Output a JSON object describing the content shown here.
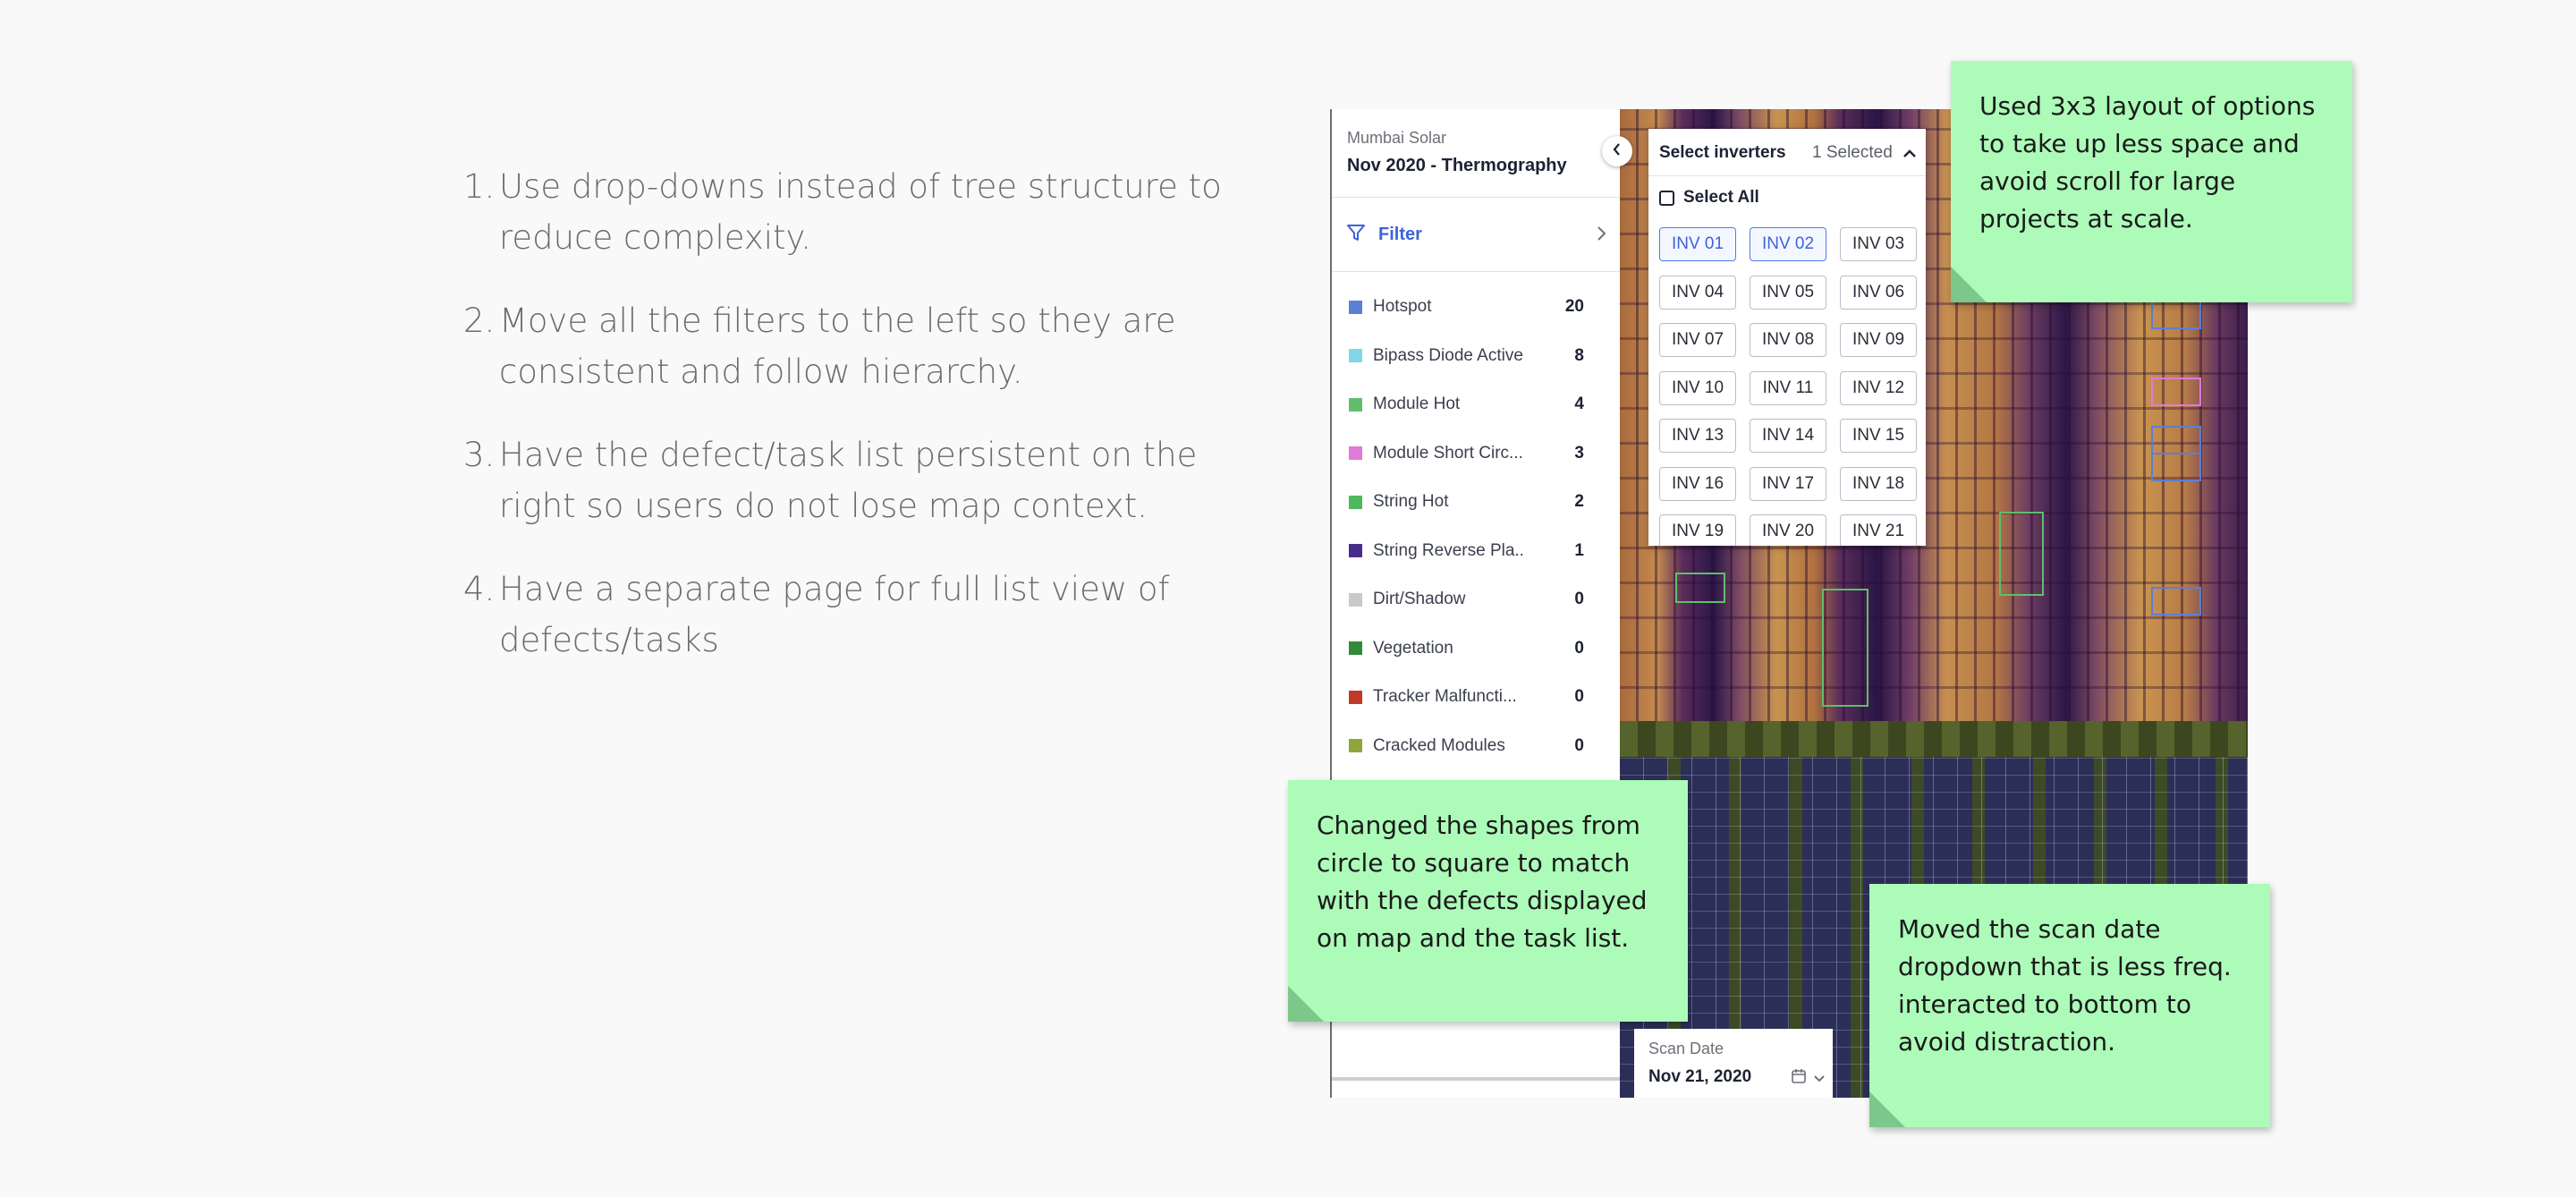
{
  "notes": [
    {
      "num": "1.",
      "text": "Use drop-downs instead of tree structure to reduce complexity."
    },
    {
      "num": "2.",
      "text": "Move all the filters to the left so they are consistent and follow hierarchy."
    },
    {
      "num": "3.",
      "text": "Have the defect/task list persistent on the right so users do not lose map context."
    },
    {
      "num": "4.",
      "text": "Have a separate page for full list view of defects/tasks"
    }
  ],
  "panel": {
    "site": "Mumbai Solar",
    "scan": "Nov 2020 - Thermography",
    "filter_label": "Filter",
    "defects": [
      {
        "name": "Hotspot",
        "count": "20",
        "color": "#5b7fd4"
      },
      {
        "name": "Bipass Diode Active",
        "count": "8",
        "color": "#7fd7e8"
      },
      {
        "name": "Module Hot",
        "count": "4",
        "color": "#5fbf6a"
      },
      {
        "name": "Module Short Circ...",
        "count": "3",
        "color": "#e07ad8"
      },
      {
        "name": "String Hot",
        "count": "2",
        "color": "#4fb85c"
      },
      {
        "name": "String Reverse Pla..",
        "count": "1",
        "color": "#4a2c8f"
      },
      {
        "name": "Dirt/Shadow",
        "count": "0",
        "color": "#c9c9c9"
      },
      {
        "name": "Vegetation",
        "count": "0",
        "color": "#2f8a3a"
      },
      {
        "name": "Tracker Malfuncti...",
        "count": "0",
        "color": "#c0392b"
      },
      {
        "name": "Cracked Modules",
        "count": "0",
        "color": "#8fa63a"
      }
    ]
  },
  "inverters": {
    "title": "Select inverters",
    "selected_text": "1 Selected",
    "select_all": "Select All",
    "options": [
      "INV 01",
      "INV 02",
      "INV 03",
      "INV 04",
      "INV 05",
      "INV 06",
      "INV 07",
      "INV 08",
      "INV 09",
      "INV 10",
      "INV 11",
      "INV 12",
      "INV 13",
      "INV 14",
      "INV 15",
      "INV 16",
      "INV 17",
      "INV 18",
      "INV 19",
      "INV 20",
      "INV 21"
    ],
    "highlighted": [
      "INV 01",
      "INV 02"
    ]
  },
  "scan_date": {
    "label": "Scan Date",
    "value": "Nov 21, 2020"
  },
  "stickies": {
    "layout": "Used 3x3 layout of options to take up less space and avoid scroll for large projects at scale.",
    "shapes": "Changed the shapes from circle to square to match with the defects displayed on map and the task list.",
    "scandate": "Moved the scan date dropdown that is less freq. interacted to bottom to avoid distraction."
  },
  "colors": {
    "accent": "#3b64d8",
    "sticky": "#adfbb9"
  }
}
